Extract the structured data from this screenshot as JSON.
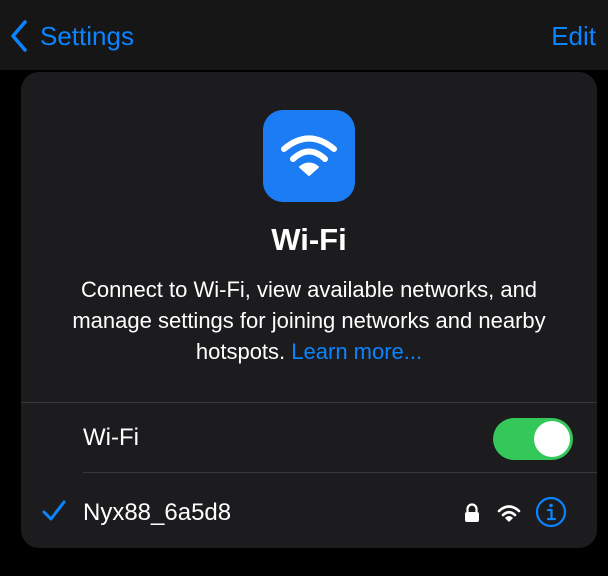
{
  "navbar": {
    "back_label": "Settings",
    "edit_label": "Edit"
  },
  "header": {
    "title": "Wi-Fi",
    "description": "Connect to Wi-Fi, view available networks, and manage settings for joining networks and nearby hotspots.",
    "learn_more": "Learn more..."
  },
  "wifi_toggle": {
    "label": "Wi-Fi",
    "state": "on"
  },
  "connected_network": {
    "name": "Nyx88_6a5d8",
    "secured": true,
    "icons": [
      "checkmark-icon",
      "lock-icon",
      "wifi-signal-icon",
      "info-icon"
    ]
  },
  "colors": {
    "accent": "#0a84ff",
    "toggle_on": "#34c759",
    "app_icon": "#1c7cf4",
    "card_background": "#1c1c1e",
    "navbar_background": "#161616",
    "page_background": "#000000"
  }
}
